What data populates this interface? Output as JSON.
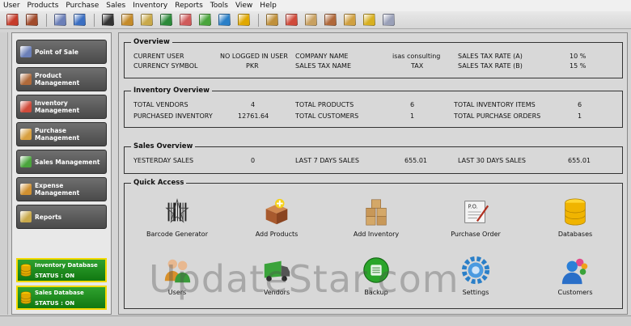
{
  "menu": [
    "User",
    "Products",
    "Purchase",
    "Sales",
    "Inventory",
    "Reports",
    "Tools",
    "View",
    "Help"
  ],
  "toolbar_icons": [
    {
      "name": "exit-icon",
      "color": "#c63b2a"
    },
    {
      "name": "login-icon",
      "color": "#a14a2a"
    },
    {
      "name": "pos-icon",
      "color": "#6b7fb8"
    },
    {
      "name": "home-icon",
      "color": "#3b6fc2"
    },
    {
      "name": "barcode-icon",
      "color": "#333333"
    },
    {
      "name": "hierarchy-icon",
      "color": "#c58b2a"
    },
    {
      "name": "report-icon",
      "color": "#c9a94a"
    },
    {
      "name": "truck-icon",
      "color": "#2c8a3a"
    },
    {
      "name": "vendors-icon",
      "color": "#d05a5a"
    },
    {
      "name": "chart-icon",
      "color": "#4aa53c"
    },
    {
      "name": "settings-icon",
      "color": "#2a7fc8"
    },
    {
      "name": "database-icon",
      "color": "#e0a800"
    },
    {
      "name": "folder-icon",
      "color": "#c0903a"
    },
    {
      "name": "inventory-icon",
      "color": "#d04a3a"
    },
    {
      "name": "boxes-icon",
      "color": "#c8a060"
    },
    {
      "name": "add-products-icon",
      "color": "#b0683a"
    },
    {
      "name": "package-icon",
      "color": "#d0a040"
    },
    {
      "name": "calculator-icon",
      "color": "#d8b020"
    },
    {
      "name": "purchase-order-icon",
      "color": "#9aa0b8"
    }
  ],
  "sidebar": {
    "items": [
      {
        "label": "Point of Sale",
        "icon": "pos-icon",
        "color": "#6b7fb8"
      },
      {
        "label": "Product Management",
        "icon": "box-icon",
        "color": "#b06a3a"
      },
      {
        "label": "Inventory Management",
        "icon": "inventory-icon",
        "color": "#d04a3a"
      },
      {
        "label": "Purchase Management",
        "icon": "purchase-icon",
        "color": "#d8a040"
      },
      {
        "label": "Sales Management",
        "icon": "sales-chart-icon",
        "color": "#4aa53c"
      },
      {
        "label": "Expense Management",
        "icon": "expense-icon",
        "color": "#d09030"
      },
      {
        "label": "Reports",
        "icon": "reports-icon",
        "color": "#c9a94a"
      }
    ],
    "databases": [
      {
        "title": "Inventory Database",
        "status": "STATUS : ON"
      },
      {
        "title": "Sales Database",
        "status": "STATUS : ON"
      }
    ]
  },
  "overview": {
    "title": "Overview",
    "current_user_label": "CURRENT USER",
    "current_user_value": "NO LOGGED IN USER",
    "currency_symbol_label": "CURRENCY SYMBOL",
    "currency_symbol_value": "PKR",
    "company_name_label": "COMPANY NAME",
    "company_name_value": "isas consulting",
    "sales_tax_name_label": "SALES TAX NAME",
    "sales_tax_name_value": "TAX",
    "tax_rate_a_label": "SALES TAX RATE (A)",
    "tax_rate_a_value": "10 %",
    "tax_rate_b_label": "SALES TAX RATE (B)",
    "tax_rate_b_value": "15 %"
  },
  "inventory_overview": {
    "title": "Inventory Overview",
    "total_vendors_label": "TOTAL VENDORS",
    "total_vendors_value": "4",
    "purchased_inventory_label": "PURCHASED INVENTORY",
    "purchased_inventory_value": "12761.64",
    "total_products_label": "TOTAL PRODUCTS",
    "total_products_value": "6",
    "total_customers_label": "TOTAL CUSTOMERS",
    "total_customers_value": "1",
    "total_inventory_items_label": "TOTAL INVENTORY ITEMS",
    "total_inventory_items_value": "6",
    "total_purchase_orders_label": "TOTAL PURCHASE ORDERS",
    "total_purchase_orders_value": "1"
  },
  "sales_overview": {
    "title": "Sales Overview",
    "yesterday_label": "YESTERDAY SALES",
    "yesterday_value": "0",
    "last7_label": "LAST 7 DAYS SALES",
    "last7_value": "655.01",
    "last30_label": "LAST 30 DAYS SALES",
    "last30_value": "655.01"
  },
  "quick_access": {
    "title": "Quick Access",
    "items": [
      {
        "label": "Barcode Generator",
        "icon": "barcode-generator-icon"
      },
      {
        "label": "Add Products",
        "icon": "add-products-icon"
      },
      {
        "label": "Add Inventory",
        "icon": "add-inventory-icon"
      },
      {
        "label": "Purchase Order",
        "icon": "purchase-order-icon",
        "text": "P.O."
      },
      {
        "label": "Databases",
        "icon": "databases-icon"
      },
      {
        "label": "Users",
        "icon": "users-icon"
      },
      {
        "label": "Vendors",
        "icon": "vendors-truck-icon"
      },
      {
        "label": "Backup",
        "icon": "backup-icon"
      },
      {
        "label": "Settings",
        "icon": "settings-gear-icon"
      },
      {
        "label": "Customers",
        "icon": "customers-icon"
      }
    ]
  },
  "watermark": "UpdateStar.com"
}
